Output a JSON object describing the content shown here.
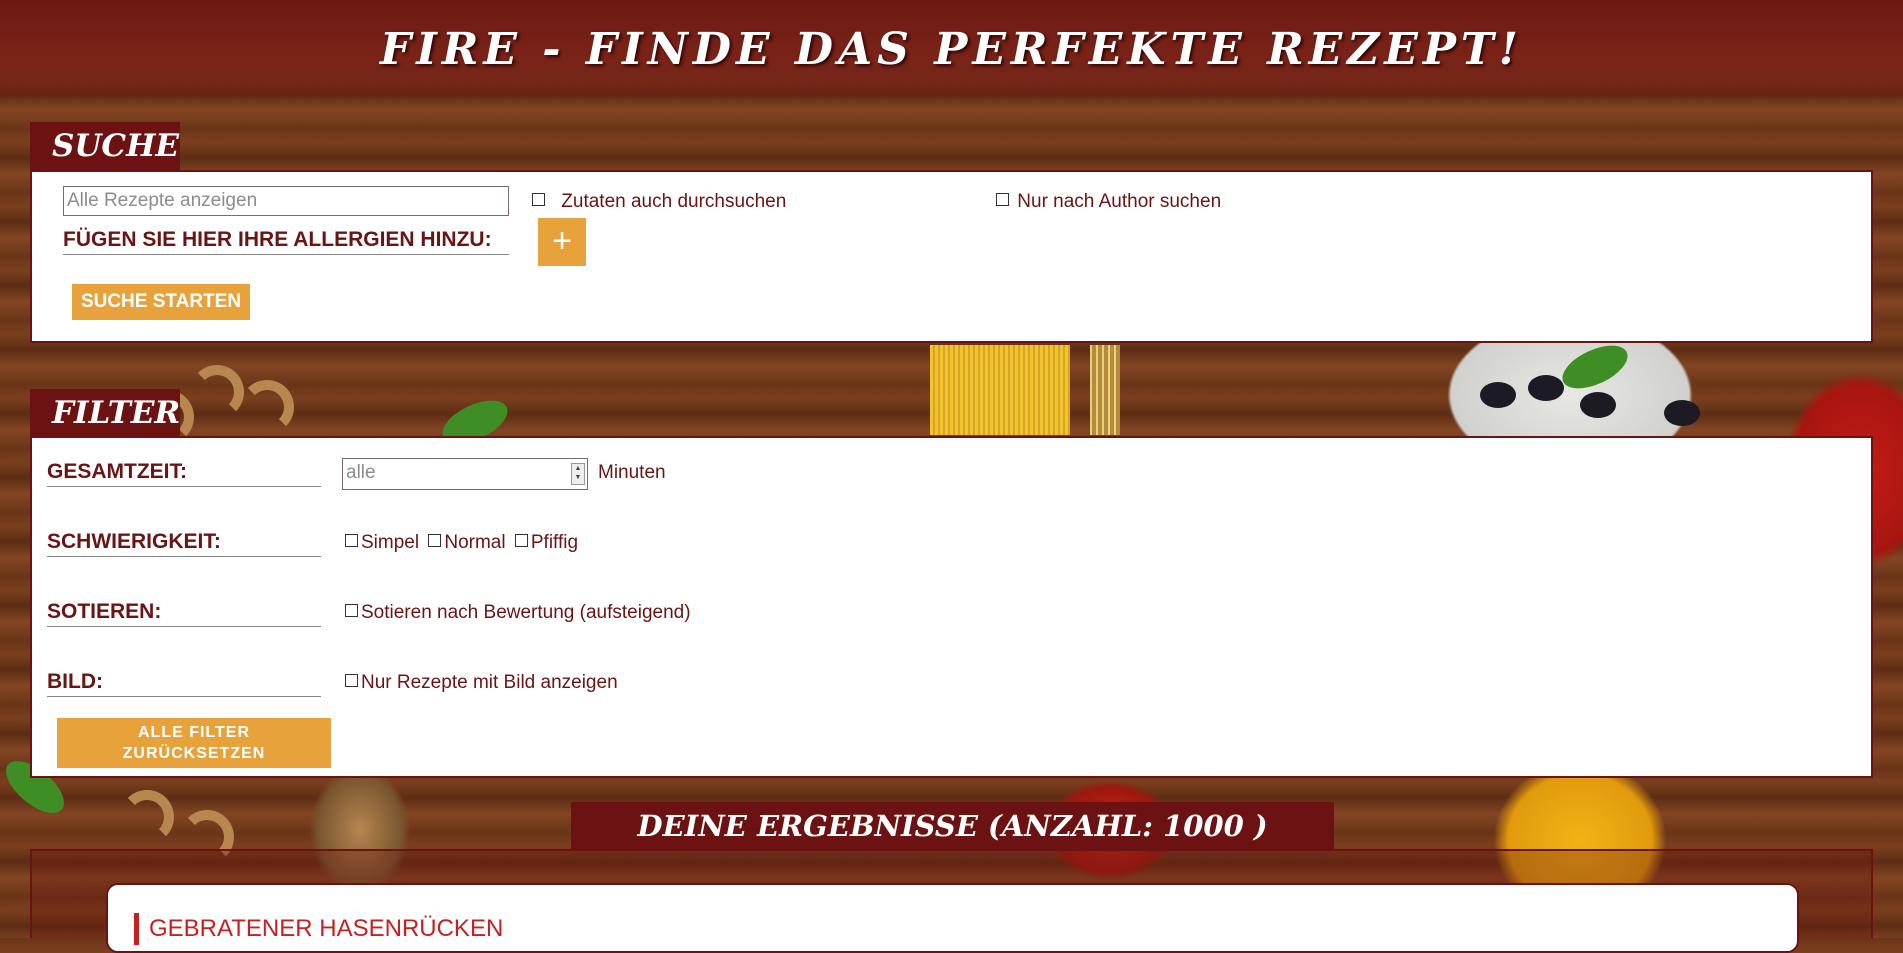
{
  "header": {
    "title": "FIRE - FINDE DAS PERFEKTE REZEPT!"
  },
  "search": {
    "tab_label": "SUCHE",
    "input_placeholder": "Alle Rezepte anzeigen",
    "ingredients_checkbox_label": "Zutaten auch durchsuchen",
    "author_checkbox_label": "Nur nach Author suchen",
    "allergies_label": "FÜGEN SIE HIER IHRE ALLERGIEN HINZU:",
    "add_button_label": "+",
    "start_button_label": "SUCHE STARTEN"
  },
  "filter": {
    "tab_label": "FILTER",
    "total_time_label": "GESAMTZEIT:",
    "total_time_placeholder": "alle",
    "total_time_unit": "Minuten",
    "difficulty_label": "SCHWIERIGKEIT:",
    "difficulty_options": [
      "Simpel",
      "Normal",
      "Pfiffig"
    ],
    "sort_label": "SOTIEREN:",
    "sort_option": "Sotieren nach Bewertung (aufsteigend)",
    "image_label": "BILD:",
    "image_option": "Nur Rezepte mit Bild anzeigen",
    "reset_button_line1": "ALLE FILTER",
    "reset_button_line2": "ZURÜCKSETZEN"
  },
  "results": {
    "title": "DEINE ERGEBNISSE (ANZAHL: 1000 )",
    "items": [
      {
        "title": "GEBRATENER HASENRÜCKEN"
      }
    ]
  },
  "colors": {
    "brand_dark_red": "#6d1212",
    "accent_orange": "#e7a23c",
    "text_red": "#6b1414",
    "recipe_title_red": "#c82020"
  }
}
